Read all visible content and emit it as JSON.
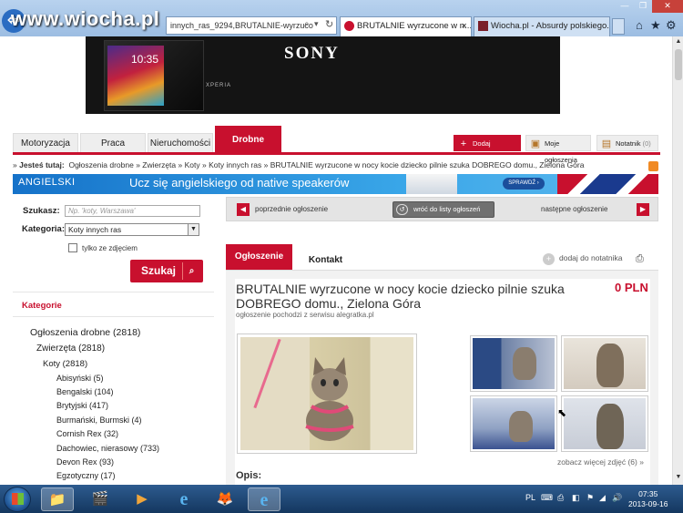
{
  "browser": {
    "address_text": "innych_ras_9294,BRUTALNIE-wyrzuco",
    "tabs": [
      {
        "label": "BRUTALNIE wyrzucone w n..."
      },
      {
        "label": "Wiocha.pl - Absurdy polskiego..."
      }
    ],
    "watermark": "www.wiocha.pl",
    "back_glyph": "⇦",
    "window_buttons": [
      "—",
      "❐",
      "✕"
    ],
    "right_icons": [
      "⌂",
      "★",
      "⚙"
    ]
  },
  "banner": {
    "brand": "SONY",
    "phone_time": "10:35",
    "phone_label": "XPERIA"
  },
  "nav": {
    "tabs": [
      "Motoryzacja",
      "Praca",
      "Nieruchomości",
      "Drobne"
    ],
    "active_tab": "Drobne",
    "actions": [
      {
        "label": "Dodaj ogłoszenie",
        "icon": "+"
      },
      {
        "label": "Moje ogłoszenia",
        "icon": "▣"
      },
      {
        "label": "Notatnik",
        "count": "(0)",
        "icon": "▤"
      }
    ]
  },
  "breadcrumb": {
    "prefix": "»",
    "label": "Jesteś tutaj:",
    "items": [
      "Ogłoszenia drobne",
      "Zwierzęta",
      "Koty",
      "Koty innych ras",
      "BRUTALNIE wyrzucone w nocy kocie dziecko pilnie szuka DOBREGO domu., Zielona Góra"
    ],
    "separator": "»"
  },
  "ad": {
    "left": "ANGIELSKI",
    "headline": "Ucz się angielskiego od native speakerów",
    "button": "SPRAWDŹ ›"
  },
  "search": {
    "szukasz_label": "Szukasz:",
    "szukasz_placeholder": "Np. 'koty, Warszawa'",
    "kategoria_label": "Kategoria:",
    "kategoria_value": "Koty innych ras",
    "photos_only_label": "tylko ze zdjęciem",
    "submit": "Szukaj",
    "submit_icon": "⌕",
    "select_arrow": "▼"
  },
  "categories": {
    "heading": "Kategorie",
    "items": [
      {
        "label": "Ogłoszenia drobne (2818)",
        "level": 0
      },
      {
        "label": "Zwierzęta (2818)",
        "level": 1
      },
      {
        "label": "Koty (2818)",
        "level": 2
      },
      {
        "label": "Abisyński (5)",
        "level": 3
      },
      {
        "label": "Bengalski (104)",
        "level": 3
      },
      {
        "label": "Brytyjski (417)",
        "level": 3
      },
      {
        "label": "Burmański, Burmski (4)",
        "level": 3
      },
      {
        "label": "Cornish Rex (32)",
        "level": 3
      },
      {
        "label": "Dachowiec, nierasowy (733)",
        "level": 3
      },
      {
        "label": "Devon Rex (93)",
        "level": 3
      },
      {
        "label": "Egzotyczny (17)",
        "level": 3
      }
    ]
  },
  "listing_nav": {
    "prev": "poprzednie ogłoszenie",
    "back": "wróć do listy ogłoszeń",
    "next": "następne ogłoszenie",
    "prev_arrow": "◀",
    "next_arrow": "▶",
    "back_icon": "↺"
  },
  "listing": {
    "tab_ad": "Ogłoszenie",
    "tab_contact": "Kontakt",
    "add_to_notebook": "dodaj do notatnika",
    "notebook_icon": "+",
    "print_icon": "⎙",
    "title": "BRUTALNIE wyrzucone w nocy kocie dziecko pilnie szuka DOBREGO domu., Zielona Góra",
    "price": "0 PLN",
    "source": "ogłoszenie pochodzi z serwisu alegratka.pl",
    "more_photos": "zobacz więcej zdjęć (6) »",
    "description_label": "Opis:"
  },
  "scrollbar": {
    "up": "▲",
    "down": "▼"
  },
  "taskbar": {
    "apps": [
      "📁",
      "🎬",
      "▶",
      "e",
      "🦊",
      "e"
    ],
    "lang": "PL",
    "tray_icons": [
      "⌨",
      "⎙",
      "◧",
      "⚑",
      "◢",
      "🔊"
    ],
    "time": "07:35",
    "date": "2013-09-16"
  },
  "colors": {
    "accent": "#c8102e",
    "taskbar": "#1f4a79"
  }
}
